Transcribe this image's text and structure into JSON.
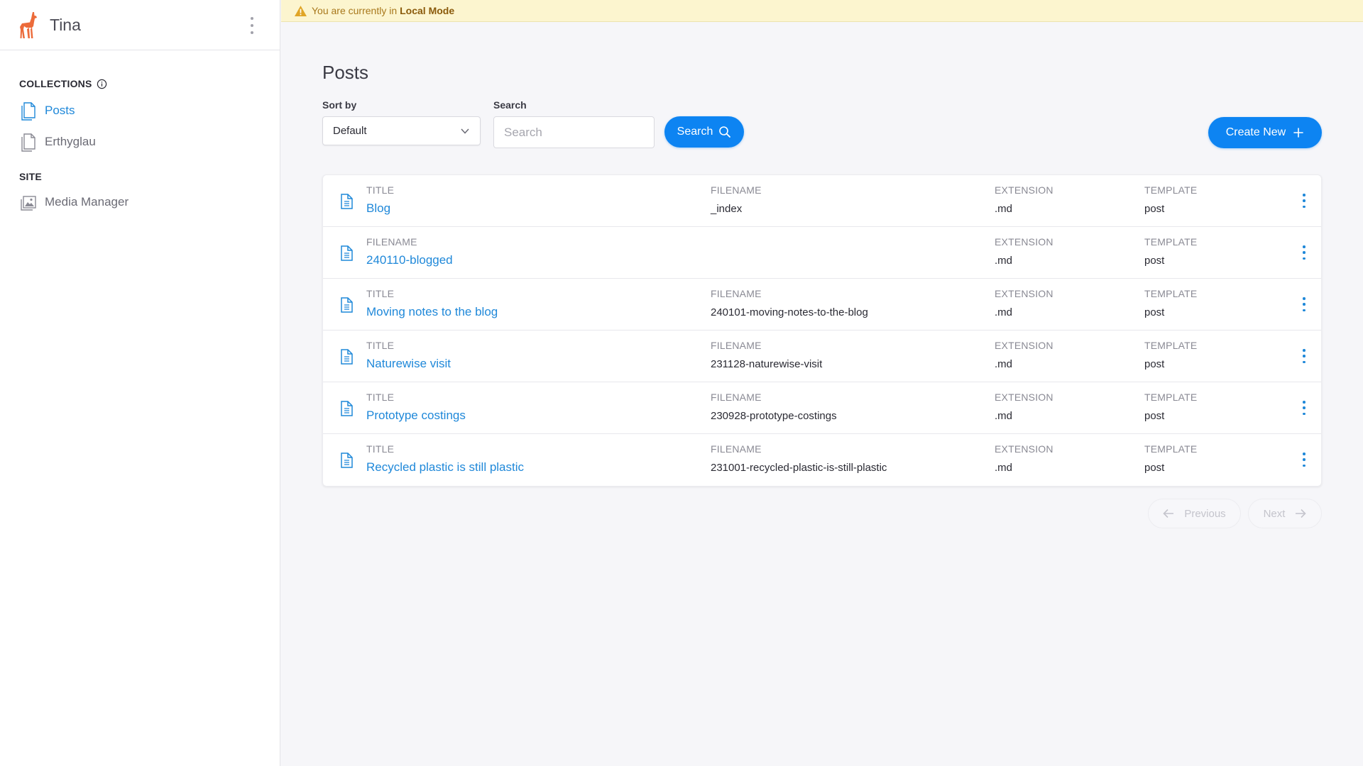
{
  "app": {
    "name": "Tina"
  },
  "banner": {
    "text": "You are currently in",
    "mode": "Local Mode"
  },
  "sidebar": {
    "collections_title": "COLLECTIONS",
    "items": [
      {
        "label": "Posts",
        "icon": "document-icon",
        "active": true
      },
      {
        "label": "Erthyglau",
        "icon": "document-icon",
        "active": false
      }
    ],
    "site_title": "SITE",
    "site_items": [
      {
        "label": "Media Manager",
        "icon": "image-icon"
      }
    ]
  },
  "main": {
    "title": "Posts",
    "sort_label": "Sort by",
    "sort_value": "Default",
    "search_label": "Search",
    "search_placeholder": "Search",
    "search_button": "Search",
    "create_button": "Create New",
    "rows": [
      {
        "c1_label": "TITLE",
        "c1_value": "Blog",
        "c2_label": "FILENAME",
        "c2_value": "_index",
        "c3_label": "EXTENSION",
        "c3_value": ".md",
        "c4_label": "TEMPLATE",
        "c4_value": "post"
      },
      {
        "c1_label": "FILENAME",
        "c1_value": "240110-blogged",
        "c2_label": "",
        "c2_value": "",
        "c3_label": "EXTENSION",
        "c3_value": ".md",
        "c4_label": "TEMPLATE",
        "c4_value": "post"
      },
      {
        "c1_label": "TITLE",
        "c1_value": "Moving notes to the blog",
        "c2_label": "FILENAME",
        "c2_value": "240101-moving-notes-to-the-blog",
        "c3_label": "EXTENSION",
        "c3_value": ".md",
        "c4_label": "TEMPLATE",
        "c4_value": "post"
      },
      {
        "c1_label": "TITLE",
        "c1_value": "Naturewise visit",
        "c2_label": "FILENAME",
        "c2_value": "231128-naturewise-visit",
        "c3_label": "EXTENSION",
        "c3_value": ".md",
        "c4_label": "TEMPLATE",
        "c4_value": "post"
      },
      {
        "c1_label": "TITLE",
        "c1_value": "Prototype costings",
        "c2_label": "FILENAME",
        "c2_value": "230928-prototype-costings",
        "c3_label": "EXTENSION",
        "c3_value": ".md",
        "c4_label": "TEMPLATE",
        "c4_value": "post"
      },
      {
        "c1_label": "TITLE",
        "c1_value": "Recycled plastic is still plastic",
        "c2_label": "FILENAME",
        "c2_value": "231001-recycled-plastic-is-still-plastic",
        "c3_label": "EXTENSION",
        "c3_value": ".md",
        "c4_label": "TEMPLATE",
        "c4_value": "post"
      }
    ],
    "pagination": {
      "previous": "Previous",
      "next": "Next"
    }
  },
  "colors": {
    "accent": "#0d84f2",
    "link": "#1f88d9",
    "banner_bg": "#fcf5cf",
    "logo": "#ec6b3a"
  }
}
